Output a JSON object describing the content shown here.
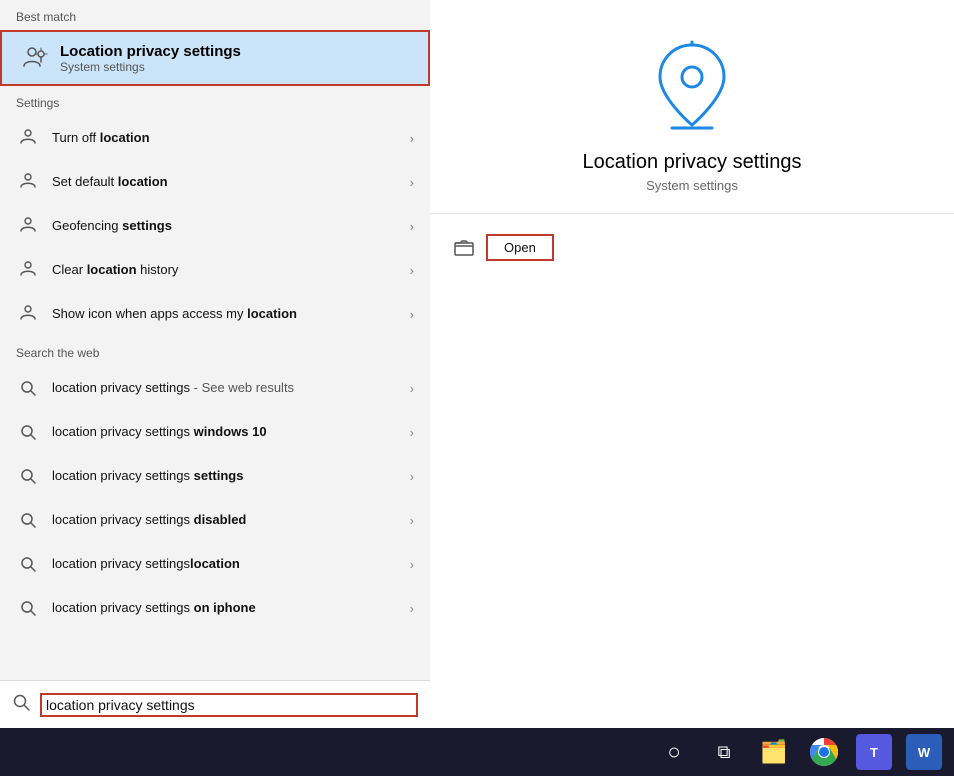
{
  "left_panel": {
    "best_match_label": "Best match",
    "best_match": {
      "title": "Location privacy settings",
      "subtitle": "System settings"
    },
    "settings_label": "Settings",
    "settings_items": [
      {
        "label": "Turn off ",
        "bold": "location"
      },
      {
        "label": "Set default ",
        "bold": "location"
      },
      {
        "label": "Geofencing ",
        "bold": "settings"
      },
      {
        "label": "Clear ",
        "bold": "location",
        "suffix": " history"
      },
      {
        "label": "Show icon when apps access my ",
        "bold": "location",
        "suffix": ""
      }
    ],
    "web_label": "Search the web",
    "web_items": [
      {
        "label": "location privacy settings",
        "subtext": " - See web results"
      },
      {
        "label": "location privacy settings ",
        "bold": "windows 10"
      },
      {
        "label": "location privacy settings ",
        "bold": "settings"
      },
      {
        "label": "location privacy settings ",
        "bold": "disabled"
      },
      {
        "label": "location privacy settings",
        "bold": "location"
      },
      {
        "label": "location privacy settings ",
        "bold": "on iphone"
      }
    ],
    "search_value": "location privacy settings"
  },
  "right_panel": {
    "title": "Location privacy settings",
    "subtitle": "System settings",
    "open_button": "Open"
  },
  "taskbar": {
    "items": [
      {
        "name": "start",
        "icon": "⊞"
      },
      {
        "name": "search",
        "icon": "○"
      },
      {
        "name": "task-view",
        "icon": "⧉"
      },
      {
        "name": "file-explorer",
        "icon": "📁"
      },
      {
        "name": "chrome",
        "icon": "●"
      },
      {
        "name": "teams",
        "label": "T"
      },
      {
        "name": "word",
        "label": "W"
      }
    ]
  }
}
